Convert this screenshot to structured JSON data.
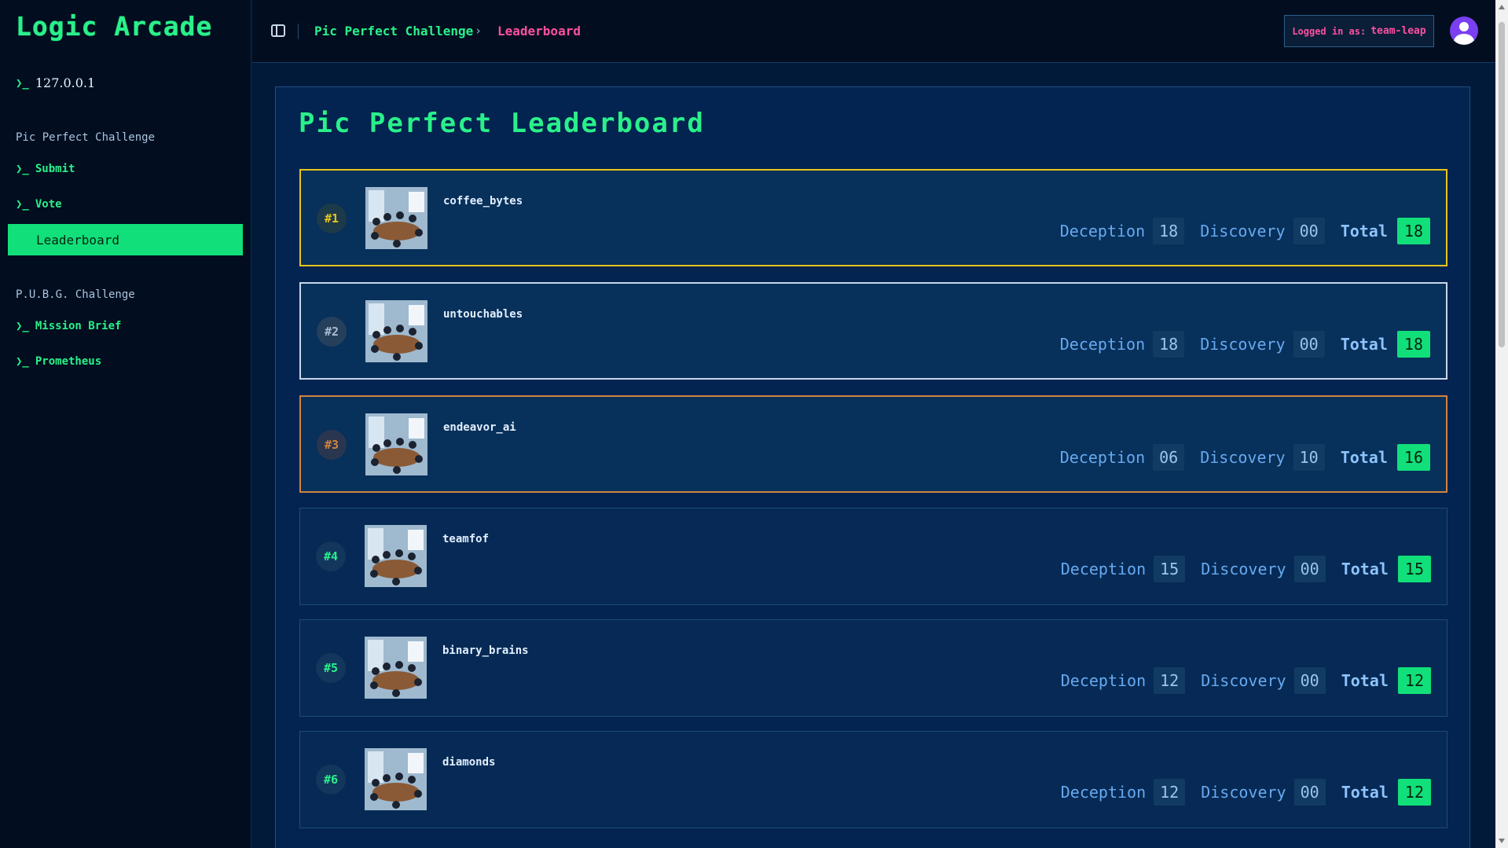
{
  "sidebar": {
    "brand": "Logic Arcade",
    "host_prompt": "❯_",
    "host": "127.0.0.1",
    "sections": [
      {
        "title": "Pic Perfect Challenge",
        "items": [
          "Submit",
          "Vote"
        ],
        "active": "Leaderboard"
      },
      {
        "title": "P.U.B.G. Challenge",
        "items": [
          "Mission Brief",
          "Prometheus"
        ]
      }
    ],
    "item_prompt": "❯_"
  },
  "header": {
    "breadcrumb": [
      "Pic Perfect Challenge",
      "Leaderboard"
    ],
    "separator": "›",
    "login_label": "Logged in as:",
    "login_user": "team-leap"
  },
  "main": {
    "title": "Pic Perfect Leaderboard",
    "labels": {
      "deception": "Deception",
      "discovery": "Discovery",
      "total": "Total"
    },
    "rows": [
      {
        "rank": "#1",
        "team": "coffee_bytes",
        "deception": "18",
        "discovery": "00",
        "total": "18"
      },
      {
        "rank": "#2",
        "team": "untouchables",
        "deception": "18",
        "discovery": "00",
        "total": "18"
      },
      {
        "rank": "#3",
        "team": "endeavor_ai",
        "deception": "06",
        "discovery": "10",
        "total": "16"
      },
      {
        "rank": "#4",
        "team": "teamfof",
        "deception": "15",
        "discovery": "00",
        "total": "15"
      },
      {
        "rank": "#5",
        "team": "binary_brains",
        "deception": "12",
        "discovery": "00",
        "total": "12"
      },
      {
        "rank": "#6",
        "team": "diamonds",
        "deception": "12",
        "discovery": "00",
        "total": "12"
      }
    ]
  },
  "colors": {
    "accent": "#2af08a",
    "pink": "#ff4fa1",
    "gold": "#e8c41a",
    "silver": "#c9d7ea",
    "bronze": "#d0843e",
    "panel": "#032350"
  }
}
